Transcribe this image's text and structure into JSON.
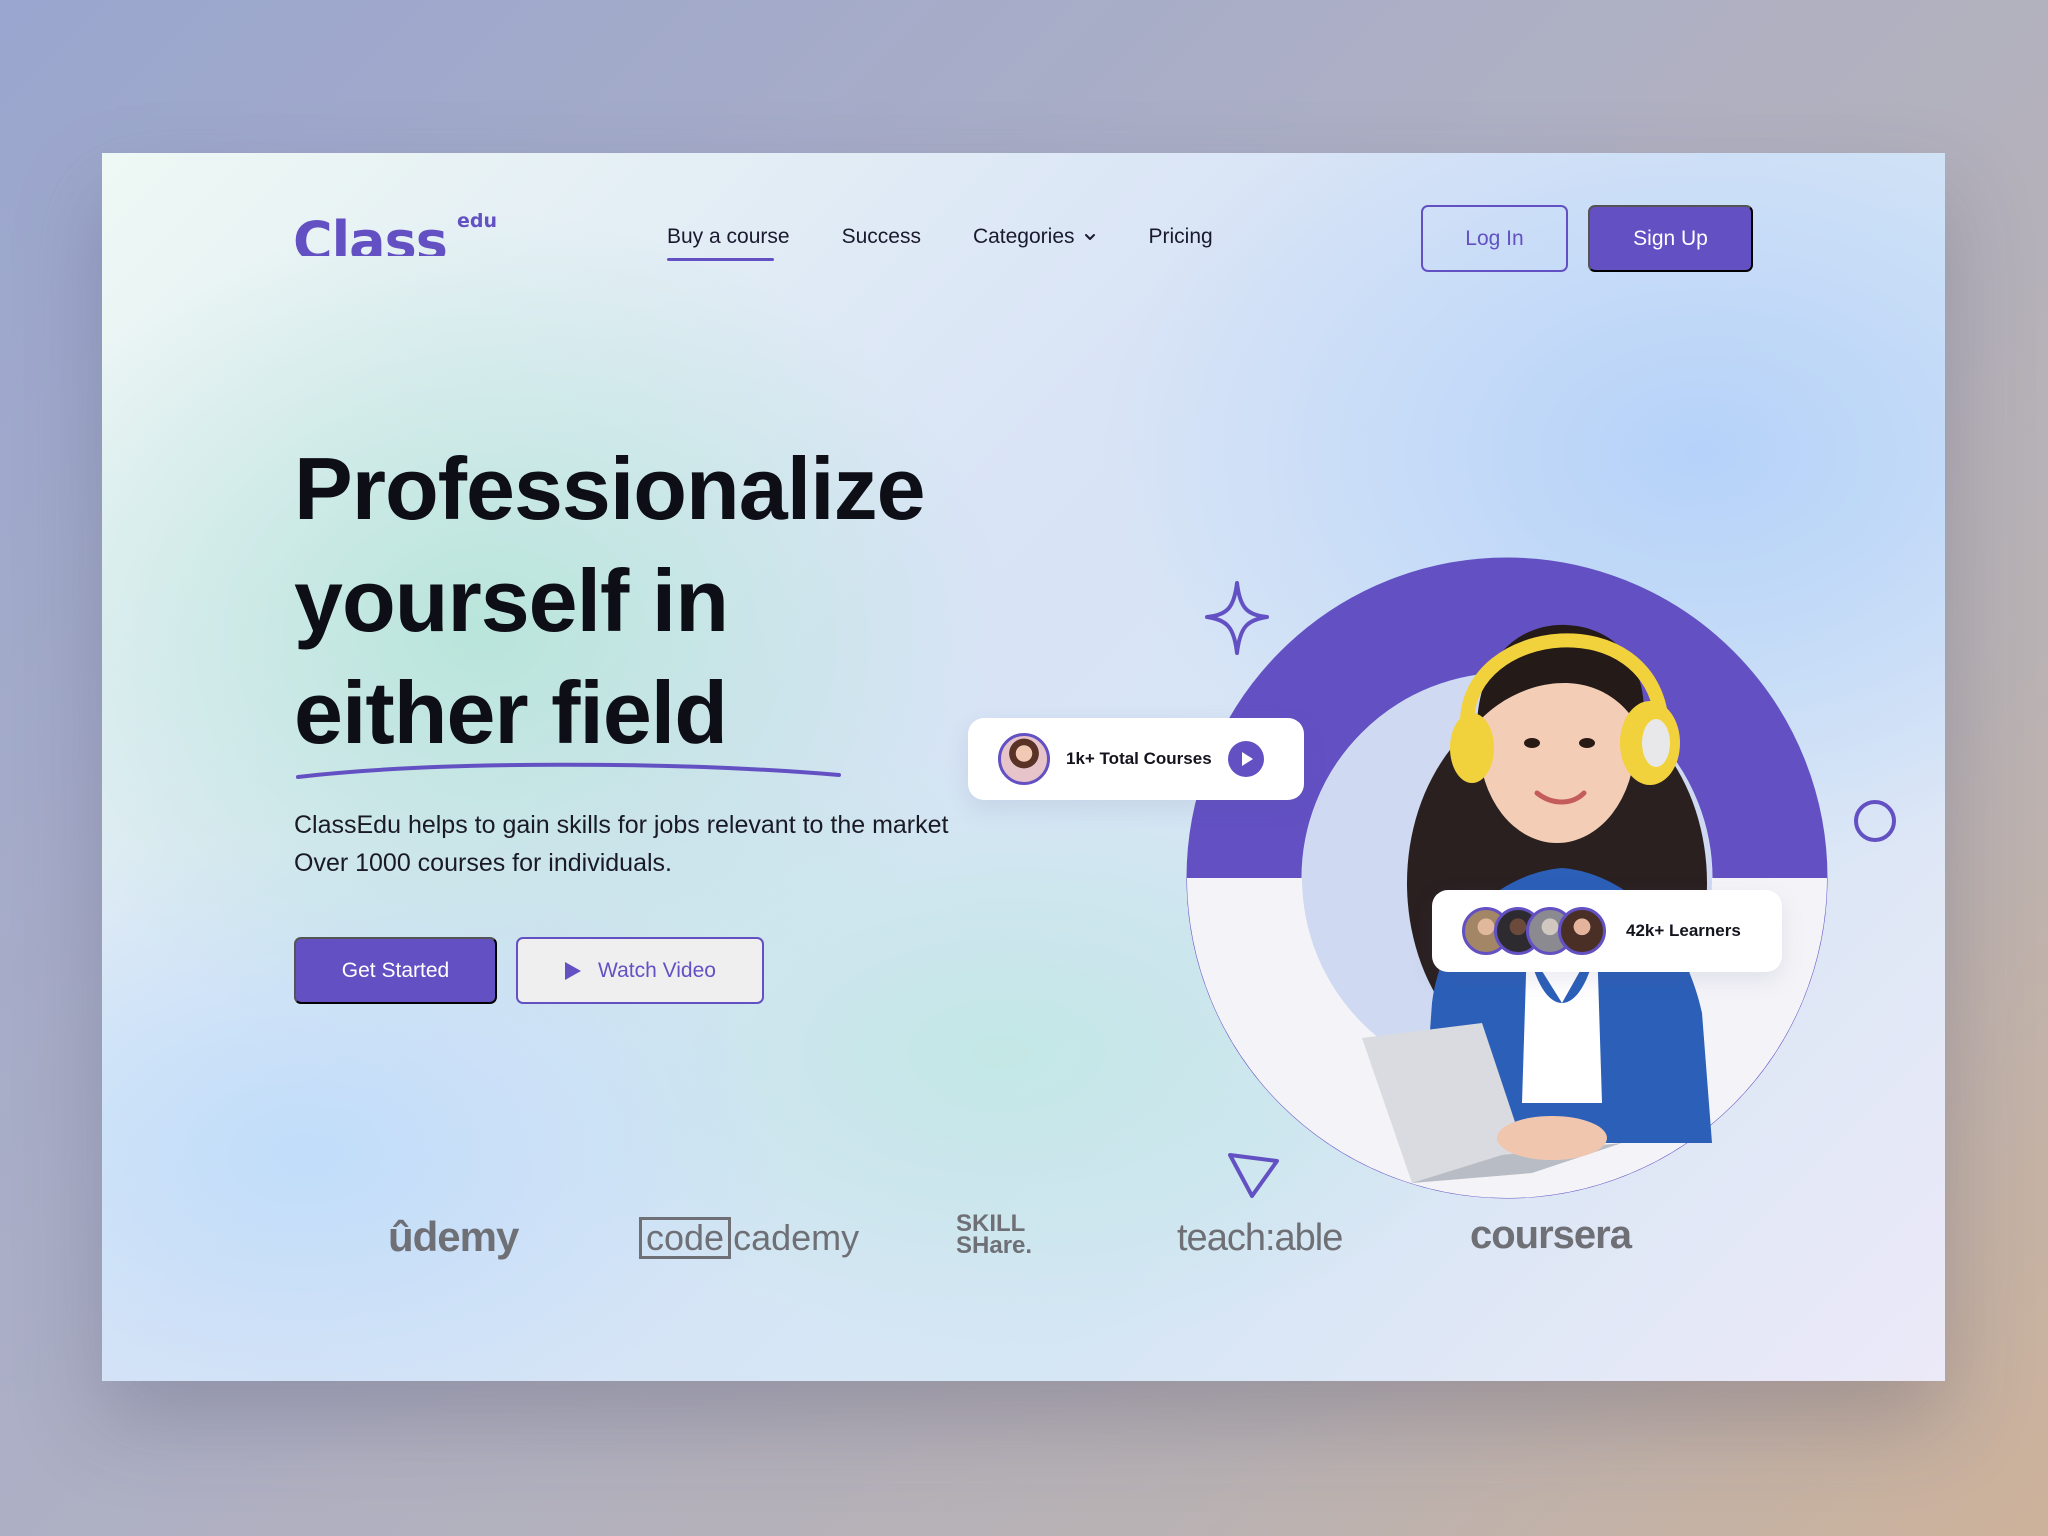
{
  "header": {
    "logo": {
      "main": "Class",
      "sup": "edu"
    },
    "nav": [
      {
        "label": "Buy a course",
        "active": true
      },
      {
        "label": "Success",
        "active": false
      },
      {
        "label": "Categories",
        "active": false,
        "dropdown": true
      },
      {
        "label": "Pricing",
        "active": false
      }
    ],
    "login_label": "Log In",
    "signup_label": "Sign Up"
  },
  "hero": {
    "headline": [
      "Professionalize",
      "yourself in",
      "either field"
    ],
    "subtext": "ClassEdu helps to gain skills for jobs relevant to the market Over 1000 courses for individuals.",
    "cta_primary": "Get Started",
    "cta_secondary": "Watch Video",
    "courses_badge": "1k+ Total Courses",
    "learners_badge": "42k+ Learners"
  },
  "partners": {
    "udemy": "ûdemy",
    "codecademy_box": "code",
    "codecademy_rest": "cademy",
    "skillshare_line1": "SKILL",
    "skillshare_line2": "SHare.",
    "teachable": "teach:able",
    "coursera": "coursera"
  },
  "colors": {
    "accent": "#6351c4",
    "text": "#0e0e16",
    "brand_gray": "#6f6f76"
  },
  "icons": [
    "chevron-down-icon",
    "play-icon",
    "sparkle-icon",
    "circle-outline-icon",
    "triangle-outline-icon"
  ]
}
